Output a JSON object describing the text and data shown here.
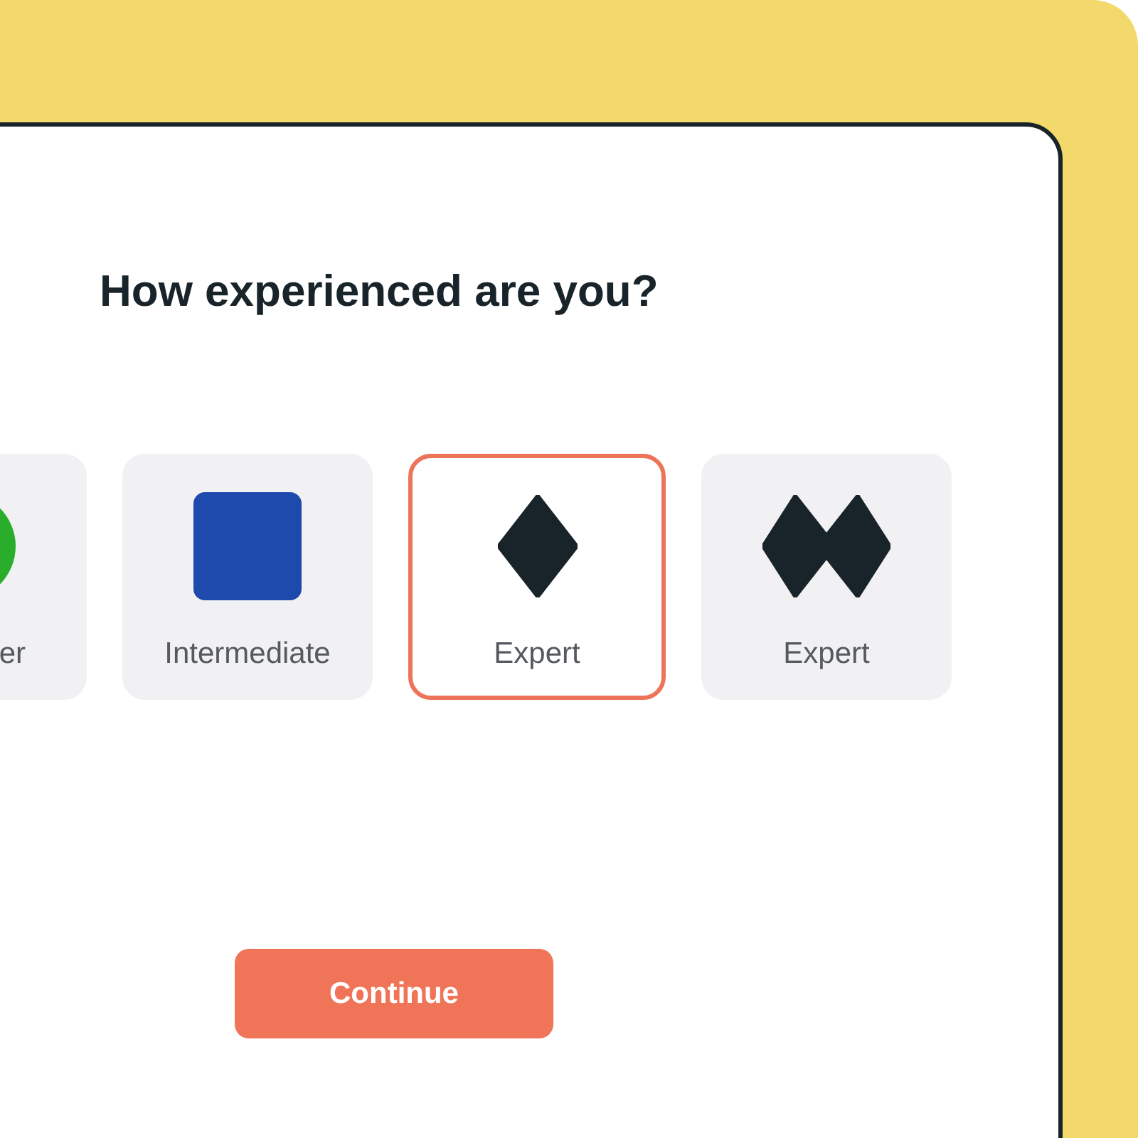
{
  "title": "How experienced are you?",
  "options": [
    {
      "label": "er",
      "kind": "circle",
      "selected": false
    },
    {
      "label": "Intermediate",
      "kind": "square",
      "selected": false
    },
    {
      "label": "Expert",
      "kind": "diamond",
      "selected": true
    },
    {
      "label": "Expert",
      "kind": "double",
      "selected": false
    }
  ],
  "button": "Continue"
}
